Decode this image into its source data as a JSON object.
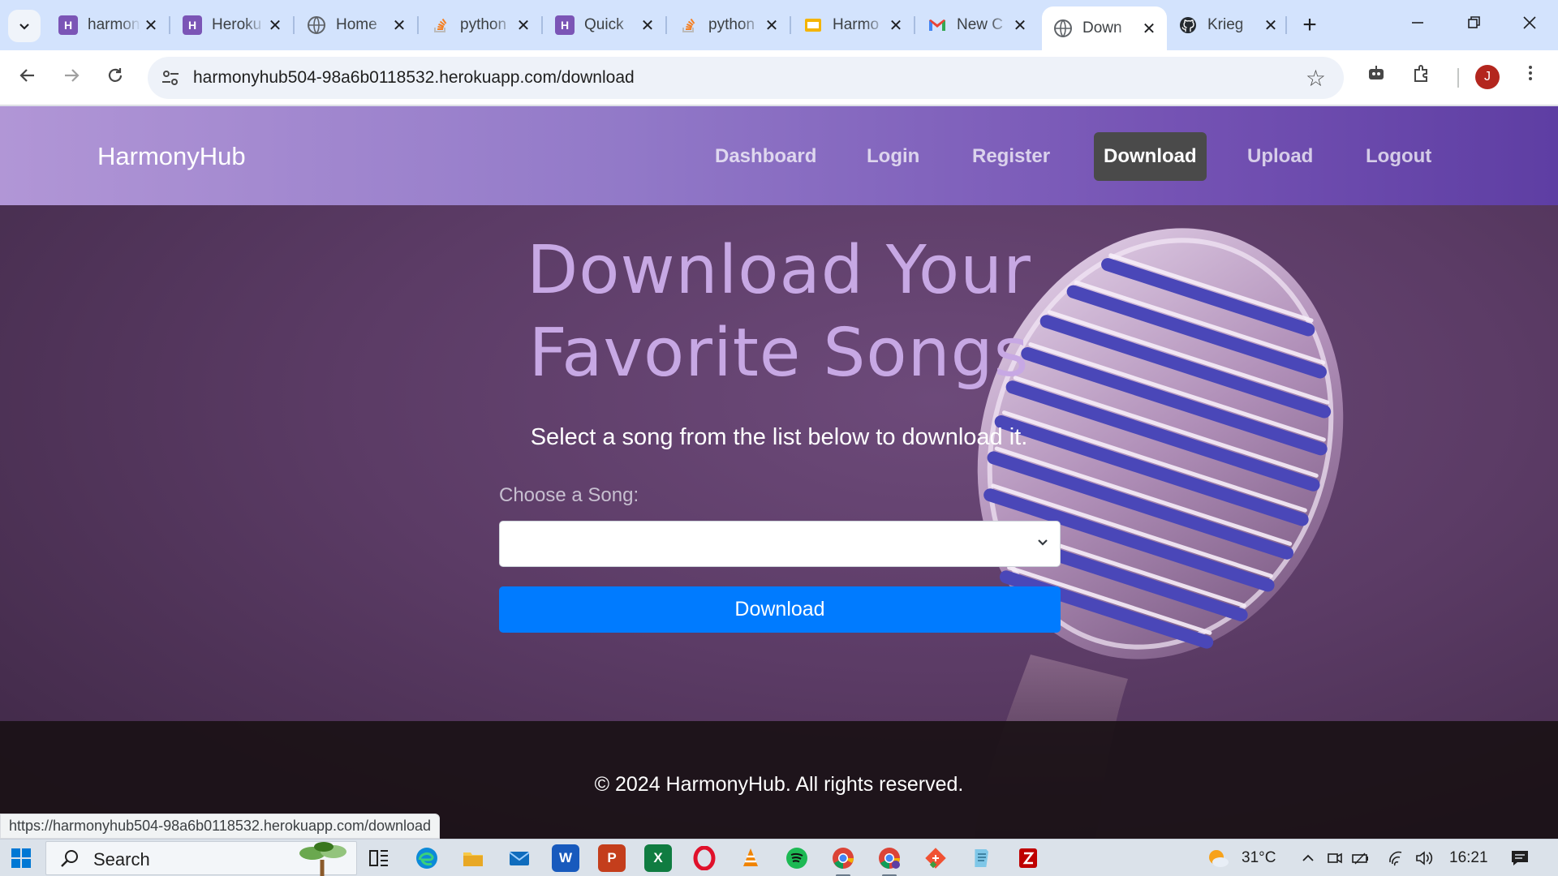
{
  "browser": {
    "tabs": [
      {
        "label": "harmonyhub",
        "favicon": "heroku-icon",
        "color": "#7b55b6",
        "glyph": "H"
      },
      {
        "label": "Heroku",
        "favicon": "heroku-icon",
        "color": "#7b55b6",
        "glyph": "H"
      },
      {
        "label": "Home",
        "favicon": "globe-icon",
        "color": "#5f6368",
        "glyph": ""
      },
      {
        "label": "python",
        "favicon": "stackoverflow-icon",
        "color": "#f48024",
        "glyph": ""
      },
      {
        "label": "Quick",
        "favicon": "heroku-icon",
        "color": "#7b55b6",
        "glyph": "H"
      },
      {
        "label": "python",
        "favicon": "stackoverflow-icon",
        "color": "#f48024",
        "glyph": ""
      },
      {
        "label": "Harmo",
        "favicon": "slides-icon",
        "color": "#f4b400",
        "glyph": ""
      },
      {
        "label": "New C",
        "favicon": "gmail-icon",
        "color": "#ea4335",
        "glyph": "M"
      },
      {
        "label": "Down",
        "favicon": "globe-icon",
        "color": "#5f6368",
        "glyph": "",
        "active": true
      },
      {
        "label": "Krieg",
        "favicon": "github-icon",
        "color": "#24292f",
        "glyph": ""
      }
    ],
    "url": "harmonyhub504-98a6b0118532.herokuapp.com/download",
    "profile_initial": "J",
    "status_url": "https://harmonyhub504-98a6b0118532.herokuapp.com/download"
  },
  "site": {
    "brand": "HarmonyHub",
    "nav": [
      {
        "label": "Dashboard",
        "active": false
      },
      {
        "label": "Login",
        "active": false
      },
      {
        "label": "Register",
        "active": false
      },
      {
        "label": "Download",
        "active": true
      },
      {
        "label": "Upload",
        "active": false
      },
      {
        "label": "Logout",
        "active": false
      }
    ],
    "hero_title_line1": "Download Your",
    "hero_title_line2": "Favorite Songs",
    "hero_subtitle": "Select a song from the list below to download it.",
    "song_label": "Choose a Song:",
    "song_selected": "",
    "download_button": "Download",
    "footer": "© 2024 HarmonyHub. All rights reserved."
  },
  "taskbar": {
    "search_placeholder": "Search",
    "apps": [
      "task-view",
      "edge",
      "file-explorer",
      "mail",
      "word",
      "powerpoint",
      "excel",
      "opera",
      "vlc",
      "spotify",
      "chrome",
      "chrome-profile",
      "git",
      "notepad",
      "filezilla"
    ],
    "weather": "31°C",
    "time": "16:21"
  },
  "colors": {
    "accent": "#007bff",
    "nav_gradient_start": "#b196d6",
    "nav_gradient_end": "#5e3ea3",
    "hero_title": "#c7a8e4"
  }
}
